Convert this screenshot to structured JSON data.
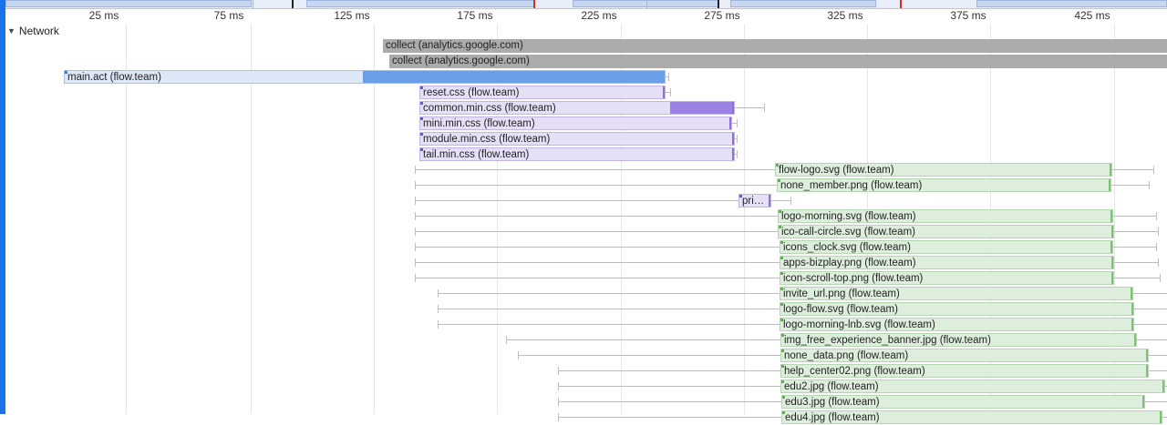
{
  "timeline": {
    "ticks": [
      "25 ms",
      "75 ms",
      "125 ms",
      "175 ms",
      "225 ms",
      "275 ms",
      "325 ms",
      "375 ms",
      "425 ms"
    ],
    "track_title": "Network"
  },
  "requests": [
    {
      "label": "collect (analytics.google.com)",
      "kind": "gray"
    },
    {
      "label": "collect (analytics.google.com)",
      "kind": "gray"
    },
    {
      "label": "main.act (flow.team)",
      "kind": "blue"
    },
    {
      "label": "reset.css (flow.team)",
      "kind": "purple"
    },
    {
      "label": "common.min.css (flow.team)",
      "kind": "purple"
    },
    {
      "label": "mini.min.css (flow.team)",
      "kind": "purple"
    },
    {
      "label": "module.min.css (flow.team)",
      "kind": "purple"
    },
    {
      "label": "tail.min.css (flow.team)",
      "kind": "purple"
    },
    {
      "label": "flow-logo.svg (flow.team)",
      "kind": "green"
    },
    {
      "label": "none_member.png (flow.team)",
      "kind": "green"
    },
    {
      "label": "pri…",
      "kind": "purple"
    },
    {
      "label": "logo-morning.svg (flow.team)",
      "kind": "green"
    },
    {
      "label": "ico-call-circle.svg (flow.team)",
      "kind": "green"
    },
    {
      "label": "icons_clock.svg (flow.team)",
      "kind": "green"
    },
    {
      "label": "apps-bizplay.png (flow.team)",
      "kind": "green"
    },
    {
      "label": "icon-scroll-top.png (flow.team)",
      "kind": "green"
    },
    {
      "label": "invite_url.png (flow.team)",
      "kind": "green"
    },
    {
      "label": "logo-flow.svg (flow.team)",
      "kind": "green"
    },
    {
      "label": "logo-morning-lnb.svg (flow.team)",
      "kind": "green"
    },
    {
      "label": "img_free_experience_banner.jpg (flow.team)",
      "kind": "green"
    },
    {
      "label": "none_data.png (flow.team)",
      "kind": "green"
    },
    {
      "label": "help_center02.png (flow.team)",
      "kind": "green"
    },
    {
      "label": "edu2.jpg (flow.team)",
      "kind": "green"
    },
    {
      "label": "edu3.jpg (flow.team)",
      "kind": "green"
    },
    {
      "label": "edu4.jpg (flow.team)",
      "kind": "green"
    }
  ],
  "colors": {
    "accent": "#1a73e8",
    "script_blue": "#6a9ee6",
    "stylesheet_purple": "#9b82e2",
    "image_green": "#7fbf76",
    "other_gray": "#ababab"
  }
}
